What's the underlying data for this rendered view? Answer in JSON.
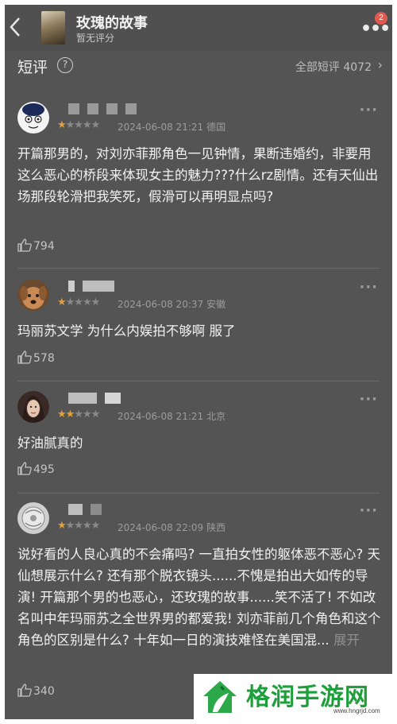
{
  "header": {
    "title": "玫瑰的故事",
    "subtitle": "暂无评分",
    "badge_count": "2"
  },
  "section": {
    "title": "短评",
    "help_icon": "?",
    "all_label": "全部短评 4072"
  },
  "reviews": [
    {
      "rating": 1,
      "date": "2024-06-08 21:21",
      "location": "德国",
      "content": "开篇那男的，对刘亦菲那角色一见钟情，果断违婚约，非要用这么恶心的桥段来体现女主的魅力???什么rz剧情。还有天仙出场那段轮滑把我笑死，假滑可以再明显点吗?",
      "likes": "794"
    },
    {
      "rating": 1,
      "date": "2024-06-08 20:37",
      "location": "安徽",
      "content": "玛丽苏文学 为什么内娱拍不够啊 服了",
      "likes": "578"
    },
    {
      "rating": 2,
      "date": "2024-06-08 21:21",
      "location": "北京",
      "content": "好油腻真的",
      "likes": "495"
    },
    {
      "rating": 1,
      "date": "2024-06-08 22:09",
      "location": "陕西",
      "content": "说好看的人良心真的不会痛吗? 一直拍女性的躯体恶不恶心? 天仙想展示什么? 还有那个脱衣镜头......不愧是拍出大如传的导演! 开篇那个男的也恶心，还玫瑰的故事......笑不活了! 不如改名叫中年玛丽苏之全世界男的都爱我! 刘亦菲前几个角色和这个角色的区别是什么? 十年如一日的演技难怪在美国混...",
      "expand": "展开",
      "likes": "340"
    }
  ],
  "watermark": {
    "text": "格润手游网",
    "url": "www.hngrjd.com"
  },
  "colors": {
    "background": "#545454",
    "star_on": "#e0a23a",
    "star_off": "#8a8a8a",
    "badge": "#e05a4f",
    "watermark_green": "#1f9e3c"
  }
}
